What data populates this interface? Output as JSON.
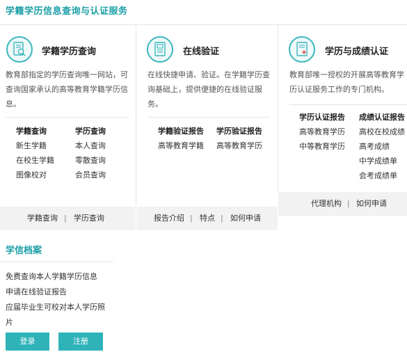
{
  "header": {
    "title": "学籍学历信息查询与认证服务"
  },
  "cards": [
    {
      "title": "学籍学历查询",
      "desc": "教育部指定的学历查询唯一网站，可查询国家承认的高等教育学籍学历信息。",
      "col1": {
        "header": "学籍查询",
        "links": [
          "新生学籍",
          "在校生学籍",
          "图像校对"
        ]
      },
      "col2": {
        "header": "学历查询",
        "links": [
          "本人查询",
          "零散查询",
          "会员查询"
        ]
      },
      "footer": [
        "学籍查询",
        "学历查询"
      ]
    },
    {
      "title": "在线验证",
      "desc": "在线快捷申请、验证。在学籍学历查询基础上，提供便捷的在线验证服务。",
      "col1": {
        "header": "学籍验证报告",
        "links": [
          "高等教育学籍"
        ]
      },
      "col2": {
        "header": "学历验证报告",
        "links": [
          "高等教育学历"
        ]
      },
      "footer": [
        "报告介绍",
        "特点",
        "如何申请"
      ]
    },
    {
      "title": "学历与成绩认证",
      "desc": "教育部唯一授权的开展高等教育学历认证服务工作的专门机构。",
      "col1": {
        "header": "学历认证报告",
        "links": [
          "高等教育学历",
          "中等教育学历"
        ]
      },
      "col2": {
        "header": "成绩认证报告",
        "links": [
          "高校在校成绩",
          "高考成绩",
          "中学成绩单",
          "会考成绩单"
        ]
      },
      "footer": [
        "代理机构",
        "如何申请"
      ]
    }
  ],
  "footer_separator": "|",
  "xuexin": {
    "title": "学信档案",
    "items": [
      "免费查询本人学籍学历信息",
      "申请在线验证报告",
      "应届毕业生可校对本人学历照片"
    ],
    "login_label": "登录",
    "register_label": "注册"
  },
  "colors": {
    "accent": "#1a9fa6",
    "button": "#2fb3b9",
    "footer_bg": "#f2f2f2"
  },
  "icons": [
    "student-record-search-icon",
    "online-verification-icon",
    "certificate-icon"
  ]
}
